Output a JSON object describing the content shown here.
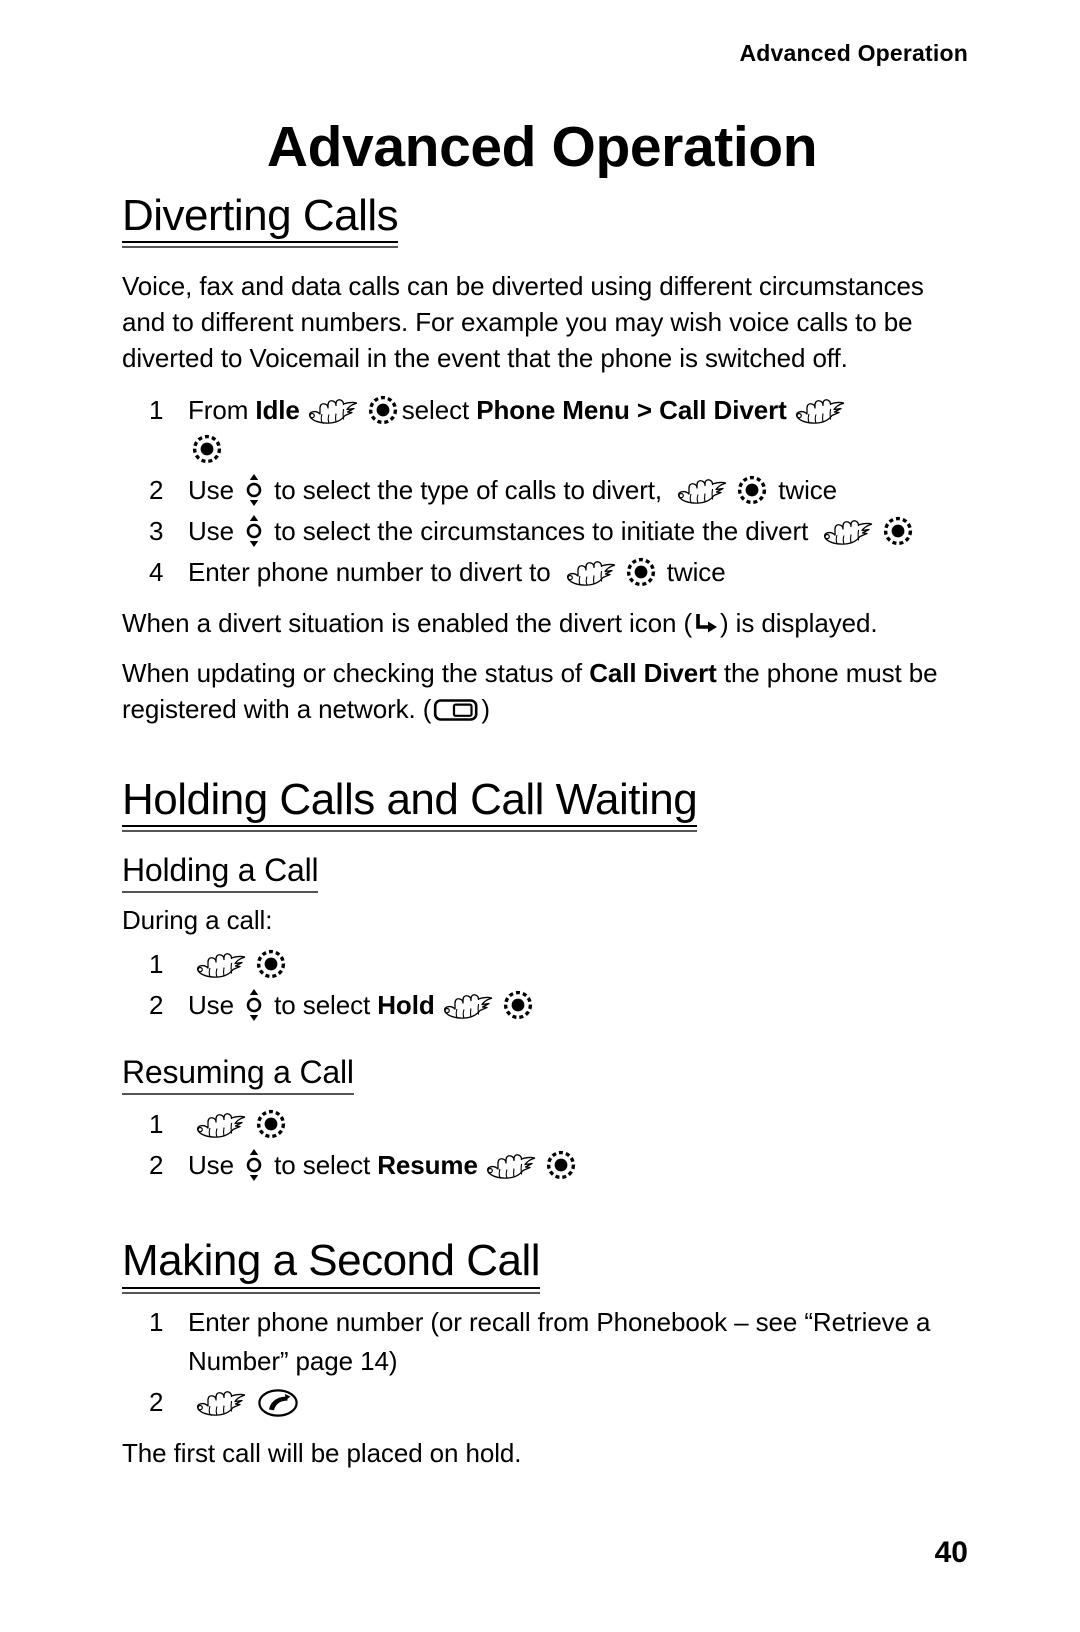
{
  "running_header": "Advanced Operation",
  "chapter_title": "Advanced Operation",
  "page_number": "40",
  "sections": {
    "diverting_calls": {
      "heading": "Diverting Calls",
      "intro": "Voice, fax and data calls can be diverted using different circumstances and to different numbers. For example you may wish voice calls to be diverted to Voicemail in the event that the phone is switched off.",
      "steps": [
        {
          "num": "1",
          "p1": "From ",
          "bold1": "Idle",
          "p2": "select ",
          "bold2": "Phone Menu",
          "p3": " > ",
          "bold3": "Call Divert"
        },
        {
          "num": "2",
          "p1": "Use ",
          "p2": " to select the type of calls to divert, ",
          "p3": " twice"
        },
        {
          "num": "3",
          "p1": "Use ",
          "p2": " to select the circumstances to initiate the divert "
        },
        {
          "num": "4",
          "p1": "Enter phone number to divert to ",
          "p2": " twice"
        }
      ],
      "note1_a": "When a divert situation is enabled the divert icon (",
      "note1_b": ") is displayed.",
      "note2_a": "When updating or checking the status of ",
      "note2_bold": "Call Divert",
      "note2_b": " the phone must be registered with a network. (",
      "note2_c": ")"
    },
    "holding_calls": {
      "heading": "Holding Calls and Call Waiting",
      "sub_holding": {
        "heading": "Holding a Call",
        "intro": "During a call:",
        "steps": [
          {
            "num": "1"
          },
          {
            "num": "2",
            "p1": "Use ",
            "p2": " to select ",
            "bold": "Hold"
          }
        ]
      },
      "sub_resuming": {
        "heading": "Resuming a Call",
        "steps": [
          {
            "num": "1"
          },
          {
            "num": "2",
            "p1": "Use ",
            "p2": " to select ",
            "bold": "Resume"
          }
        ]
      }
    },
    "second_call": {
      "heading": "Making a Second Call",
      "steps": [
        {
          "num": "1",
          "p1": "Enter phone number (or recall from Phonebook – see “Retrieve a Number” page 14)"
        },
        {
          "num": "2"
        }
      ],
      "closing": "The first call will be placed on hold."
    }
  },
  "icons": {
    "hand": "pointing-hand-icon",
    "select_key": "select-key-icon",
    "scroll_key": "scroll-key-icon",
    "divert": "divert-icon",
    "network": "network-registered-icon",
    "send_key": "send-key-icon"
  },
  "colors": {
    "text": "#000000",
    "rule": "#555555",
    "background": "#ffffff"
  }
}
